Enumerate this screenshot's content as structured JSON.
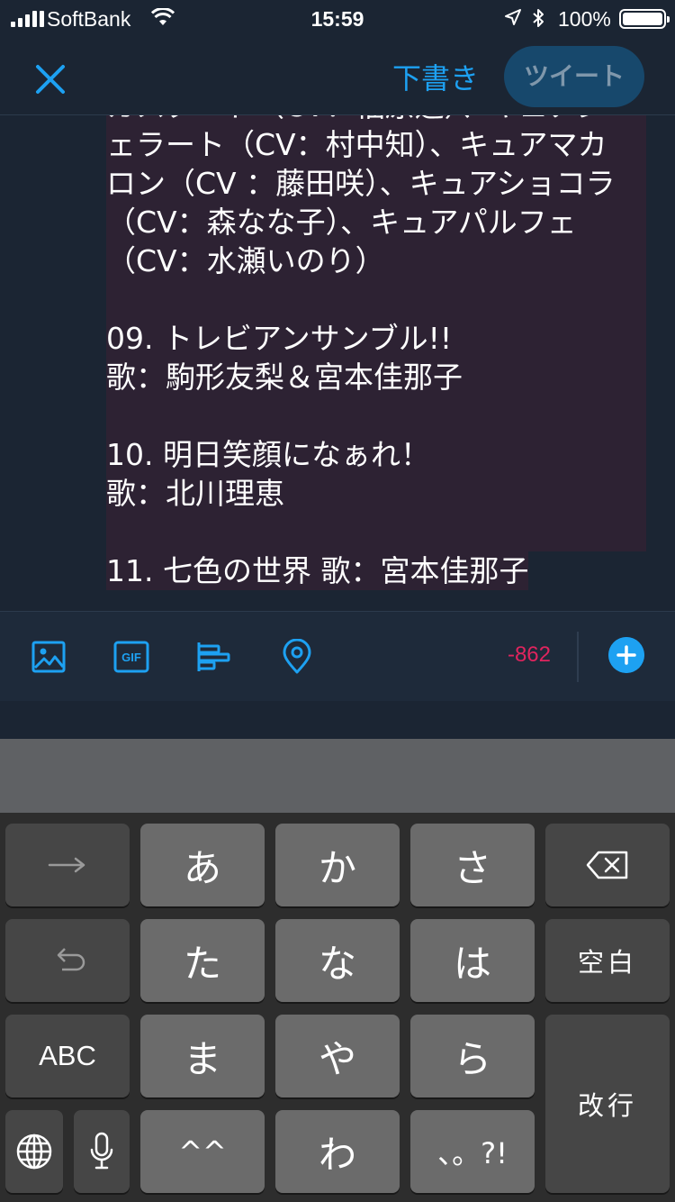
{
  "status_bar": {
    "carrier": "SoftBank",
    "time": "15:59",
    "battery": "100%",
    "battery_level": 1.0
  },
  "header": {
    "close_icon": "close-x-icon",
    "draft_label": "下書き",
    "tweet_label": "ツイート"
  },
  "compose": {
    "lines": [
      "カスタード（CV：福原遥）、キュアジ",
      "ェラート（CV：村中知）、キュアマカ",
      "ロン（CV ：藤田咲）、キュアショコラ",
      "（CV：森なな子）、キュアパルフェ",
      "（CV：水瀬いのり）",
      "",
      "09. トレビアンサンブル!!",
      " 歌：駒形友梨＆宮本佳那子",
      "",
      "10. 明日笑顔になぁれ！",
      " 歌：北川理恵",
      ""
    ],
    "last_line": "11. 七色の世界 歌：宮本佳那子"
  },
  "toolbar": {
    "icons": [
      "image-icon",
      "gif-icon",
      "poll-icon",
      "location-pin-icon"
    ],
    "gif_label": "GIF",
    "char_count": "-862",
    "add_icon": "plus-icon"
  },
  "keyboard": {
    "row1": [
      "→",
      "あ",
      "か",
      "さ",
      "⌫"
    ],
    "row2": [
      "↺",
      "た",
      "な",
      "は",
      "空白"
    ],
    "row3": [
      "ABC",
      "ま",
      "や",
      "ら"
    ],
    "row4": [
      "🌐",
      "🎤",
      "^^",
      "わ",
      "、。?!"
    ],
    "return_label": "改行",
    "colors": {
      "key": "#6b6b6b",
      "function_key": "#464646",
      "background": "#2d2d2d"
    }
  },
  "colors": {
    "accent": "#1da1f2",
    "counter_over": "#e0245e",
    "background": "#1b2533",
    "text_highlight": "#2d2233"
  }
}
